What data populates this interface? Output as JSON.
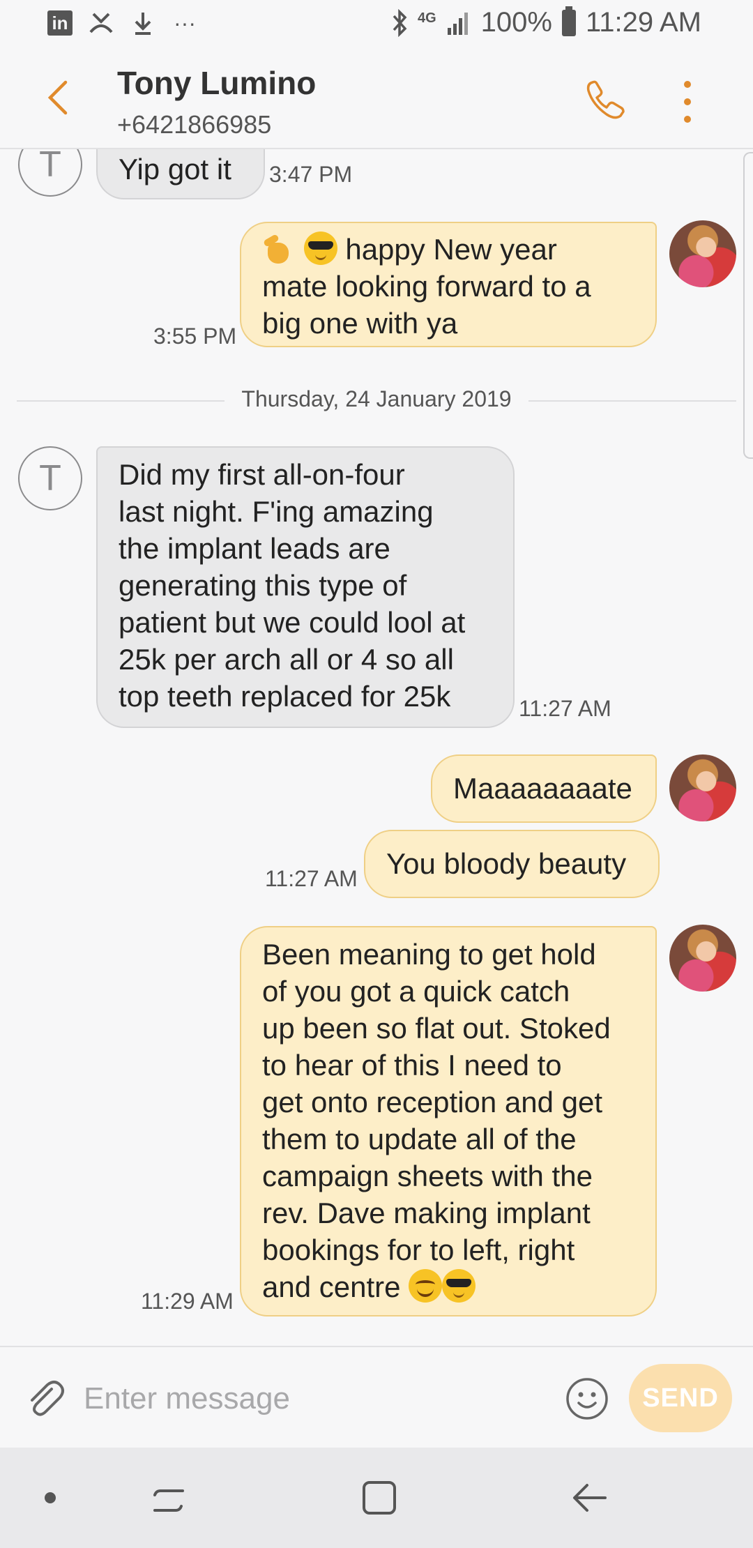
{
  "status_bar": {
    "linkedin_label": "in",
    "more": "···",
    "network": "4G",
    "battery": "100%",
    "time": "11:29 AM"
  },
  "header": {
    "name": "Tony Lumino",
    "number": "+6421866985"
  },
  "thread": {
    "avatar_initial": "T",
    "messages": [
      {
        "dir": "in",
        "text": "Yip got it",
        "time": "3:47 PM"
      },
      {
        "dir": "out",
        "lines": [
          "happy New year",
          "mate looking forward to a",
          "big one with ya"
        ],
        "time": "3:55 PM"
      },
      {
        "dir": "in",
        "lines": [
          "Did my first all-on-four",
          "last night. F'ing amazing",
          "the implant leads are",
          "generating this type of",
          "patient but we could lool at",
          "25k per arch all or 4 so all",
          "top teeth replaced for 25k"
        ],
        "time": "11:27 AM"
      },
      {
        "dir": "out",
        "text": "Maaaaaaaate"
      },
      {
        "dir": "out",
        "text": "You bloody beauty",
        "time": "11:27 AM"
      },
      {
        "dir": "out",
        "lines": [
          "Been meaning to get hold",
          "of you got a quick catch",
          "up been so flat out. Stoked",
          "to hear of this I need to",
          "get onto reception and get",
          "them to update all of the",
          "campaign sheets with the",
          "rev. Dave making implant",
          "bookings for to left, right",
          "and centre"
        ],
        "time": "11:29 AM"
      }
    ],
    "date_separator": "Thursday, 24 January 2019"
  },
  "composer": {
    "placeholder": "Enter message",
    "send_label": "SEND"
  },
  "colors": {
    "accent": "#e08a2c",
    "out_bubble": "#fdeec8",
    "in_bubble": "#e9e9ea",
    "send_button": "#fbdfae"
  }
}
